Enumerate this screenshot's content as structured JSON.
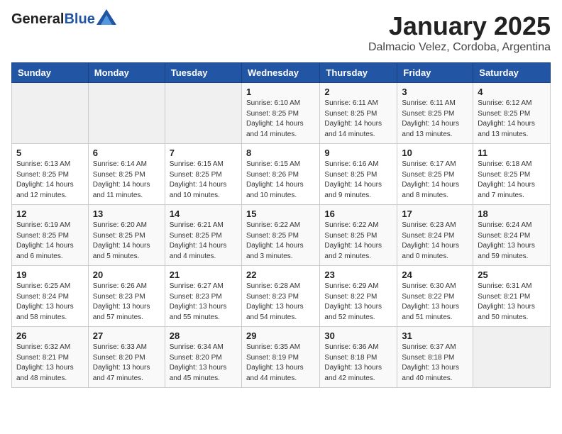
{
  "header": {
    "logo_general": "General",
    "logo_blue": "Blue",
    "title": "January 2025",
    "subtitle": "Dalmacio Velez, Cordoba, Argentina"
  },
  "weekdays": [
    "Sunday",
    "Monday",
    "Tuesday",
    "Wednesday",
    "Thursday",
    "Friday",
    "Saturday"
  ],
  "weeks": [
    [
      {
        "day": "",
        "info": ""
      },
      {
        "day": "",
        "info": ""
      },
      {
        "day": "",
        "info": ""
      },
      {
        "day": "1",
        "info": "Sunrise: 6:10 AM\nSunset: 8:25 PM\nDaylight: 14 hours and 14 minutes."
      },
      {
        "day": "2",
        "info": "Sunrise: 6:11 AM\nSunset: 8:25 PM\nDaylight: 14 hours and 14 minutes."
      },
      {
        "day": "3",
        "info": "Sunrise: 6:11 AM\nSunset: 8:25 PM\nDaylight: 14 hours and 13 minutes."
      },
      {
        "day": "4",
        "info": "Sunrise: 6:12 AM\nSunset: 8:25 PM\nDaylight: 14 hours and 13 minutes."
      }
    ],
    [
      {
        "day": "5",
        "info": "Sunrise: 6:13 AM\nSunset: 8:25 PM\nDaylight: 14 hours and 12 minutes."
      },
      {
        "day": "6",
        "info": "Sunrise: 6:14 AM\nSunset: 8:25 PM\nDaylight: 14 hours and 11 minutes."
      },
      {
        "day": "7",
        "info": "Sunrise: 6:15 AM\nSunset: 8:25 PM\nDaylight: 14 hours and 10 minutes."
      },
      {
        "day": "8",
        "info": "Sunrise: 6:15 AM\nSunset: 8:26 PM\nDaylight: 14 hours and 10 minutes."
      },
      {
        "day": "9",
        "info": "Sunrise: 6:16 AM\nSunset: 8:25 PM\nDaylight: 14 hours and 9 minutes."
      },
      {
        "day": "10",
        "info": "Sunrise: 6:17 AM\nSunset: 8:25 PM\nDaylight: 14 hours and 8 minutes."
      },
      {
        "day": "11",
        "info": "Sunrise: 6:18 AM\nSunset: 8:25 PM\nDaylight: 14 hours and 7 minutes."
      }
    ],
    [
      {
        "day": "12",
        "info": "Sunrise: 6:19 AM\nSunset: 8:25 PM\nDaylight: 14 hours and 6 minutes."
      },
      {
        "day": "13",
        "info": "Sunrise: 6:20 AM\nSunset: 8:25 PM\nDaylight: 14 hours and 5 minutes."
      },
      {
        "day": "14",
        "info": "Sunrise: 6:21 AM\nSunset: 8:25 PM\nDaylight: 14 hours and 4 minutes."
      },
      {
        "day": "15",
        "info": "Sunrise: 6:22 AM\nSunset: 8:25 PM\nDaylight: 14 hours and 3 minutes."
      },
      {
        "day": "16",
        "info": "Sunrise: 6:22 AM\nSunset: 8:25 PM\nDaylight: 14 hours and 2 minutes."
      },
      {
        "day": "17",
        "info": "Sunrise: 6:23 AM\nSunset: 8:24 PM\nDaylight: 14 hours and 0 minutes."
      },
      {
        "day": "18",
        "info": "Sunrise: 6:24 AM\nSunset: 8:24 PM\nDaylight: 13 hours and 59 minutes."
      }
    ],
    [
      {
        "day": "19",
        "info": "Sunrise: 6:25 AM\nSunset: 8:24 PM\nDaylight: 13 hours and 58 minutes."
      },
      {
        "day": "20",
        "info": "Sunrise: 6:26 AM\nSunset: 8:23 PM\nDaylight: 13 hours and 57 minutes."
      },
      {
        "day": "21",
        "info": "Sunrise: 6:27 AM\nSunset: 8:23 PM\nDaylight: 13 hours and 55 minutes."
      },
      {
        "day": "22",
        "info": "Sunrise: 6:28 AM\nSunset: 8:23 PM\nDaylight: 13 hours and 54 minutes."
      },
      {
        "day": "23",
        "info": "Sunrise: 6:29 AM\nSunset: 8:22 PM\nDaylight: 13 hours and 52 minutes."
      },
      {
        "day": "24",
        "info": "Sunrise: 6:30 AM\nSunset: 8:22 PM\nDaylight: 13 hours and 51 minutes."
      },
      {
        "day": "25",
        "info": "Sunrise: 6:31 AM\nSunset: 8:21 PM\nDaylight: 13 hours and 50 minutes."
      }
    ],
    [
      {
        "day": "26",
        "info": "Sunrise: 6:32 AM\nSunset: 8:21 PM\nDaylight: 13 hours and 48 minutes."
      },
      {
        "day": "27",
        "info": "Sunrise: 6:33 AM\nSunset: 8:20 PM\nDaylight: 13 hours and 47 minutes."
      },
      {
        "day": "28",
        "info": "Sunrise: 6:34 AM\nSunset: 8:20 PM\nDaylight: 13 hours and 45 minutes."
      },
      {
        "day": "29",
        "info": "Sunrise: 6:35 AM\nSunset: 8:19 PM\nDaylight: 13 hours and 44 minutes."
      },
      {
        "day": "30",
        "info": "Sunrise: 6:36 AM\nSunset: 8:18 PM\nDaylight: 13 hours and 42 minutes."
      },
      {
        "day": "31",
        "info": "Sunrise: 6:37 AM\nSunset: 8:18 PM\nDaylight: 13 hours and 40 minutes."
      },
      {
        "day": "",
        "info": ""
      }
    ]
  ]
}
